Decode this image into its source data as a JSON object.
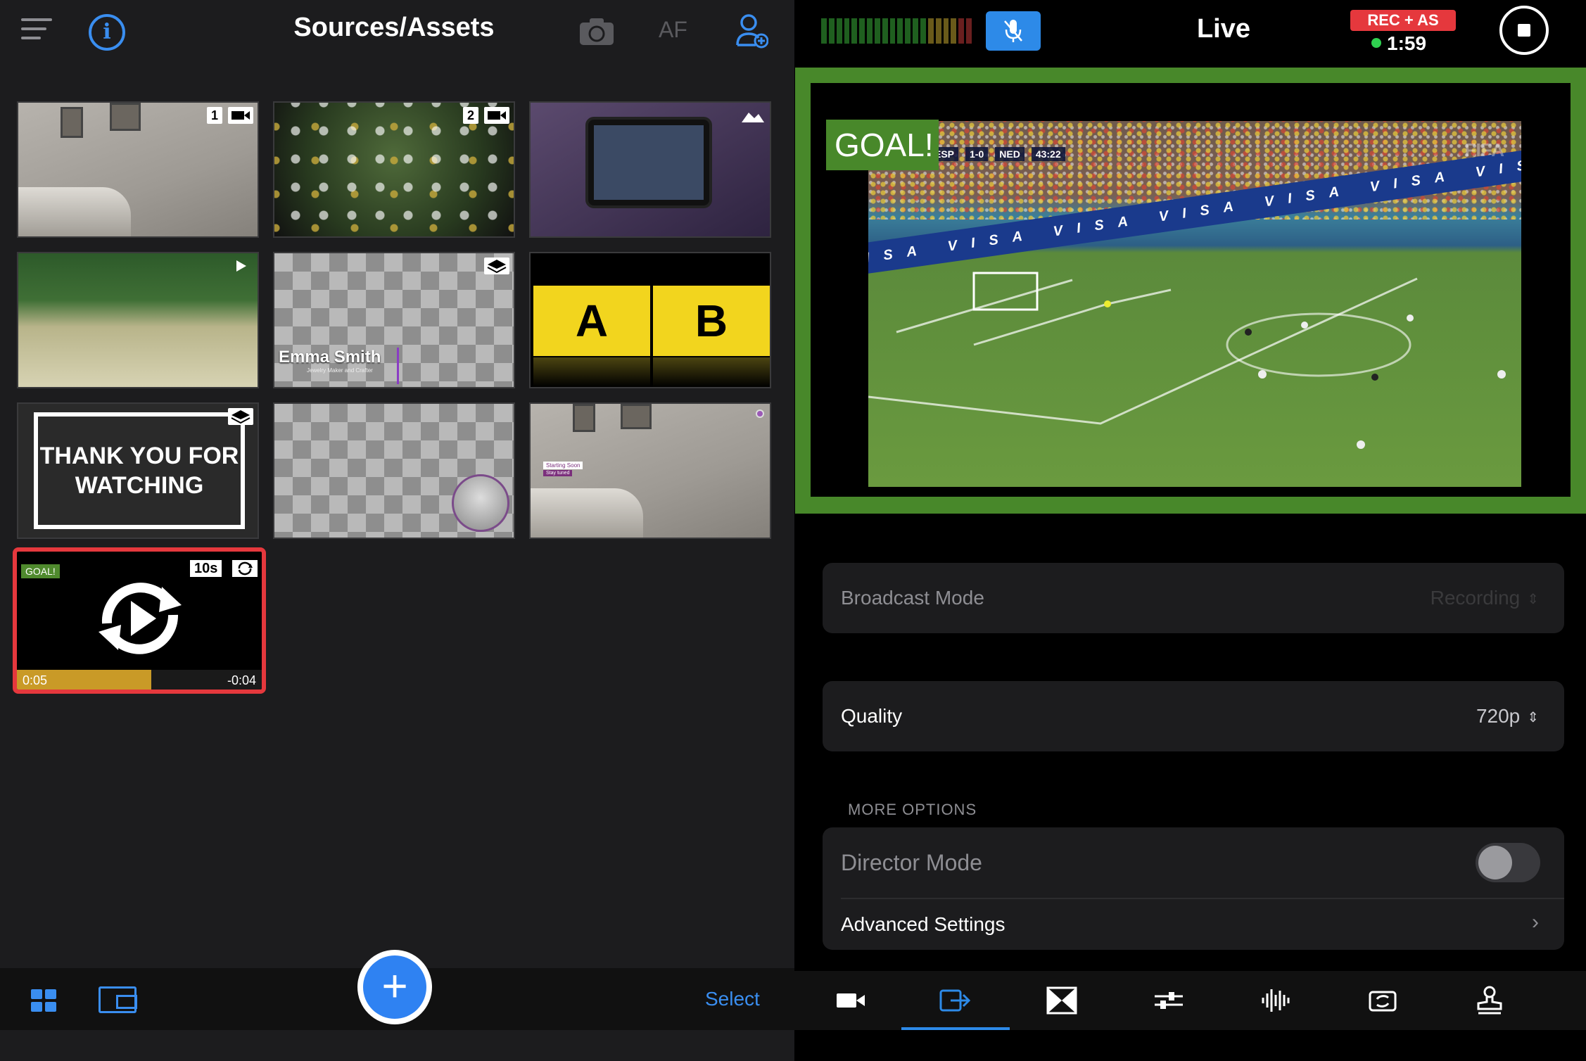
{
  "left_panel": {
    "title": "Sources/Assets",
    "af_label": "AF",
    "select_label": "Select",
    "tiles": [
      {
        "badge": "1"
      },
      {
        "badge": "2"
      },
      {
        "badge": ""
      },
      {
        "badge": ""
      },
      {
        "lower_third_name": "Emma Smith",
        "lower_third_sub": "Jewelry Maker and Crafter"
      },
      {
        "letter_a": "A",
        "letter_b": "B"
      },
      {
        "thanks_text": "THANK YOU FOR WATCHING"
      },
      {},
      {
        "overlay_title": "Starting Soon",
        "overlay_sub": "Stay tuned"
      }
    ],
    "active_clip": {
      "tag": "GOAL!",
      "duration": "10s",
      "elapsed": "0:05",
      "remaining": "-0:04",
      "progress": 0.55
    }
  },
  "right_panel": {
    "title": "Live",
    "rec_badge": "REC + AS",
    "rec_time": "1:59",
    "preview": {
      "goal_label": "GOAL!",
      "score_team1": "ESP",
      "score": "1-0",
      "score_team2": "NED",
      "match_clock": "43:22",
      "watermark": "FIFA",
      "board_text": "VISA VISA VISA VISA VISA VISA VISA VISA VISA VISA"
    },
    "settings": {
      "broadcast_mode_label": "Broadcast Mode",
      "broadcast_mode_value": "Recording",
      "quality_label": "Quality",
      "quality_value": "720p",
      "more_options_header": "MORE OPTIONS",
      "director_mode_label": "Director Mode",
      "director_mode_on": false,
      "advanced_settings_label": "Advanced Settings"
    },
    "tabs": [
      "camera-icon",
      "output-icon",
      "transition-icon",
      "adjust-icon",
      "audio-icon",
      "switch-camera-icon",
      "stamp-icon"
    ]
  },
  "colors": {
    "accent_blue": "#3a8ef0",
    "rec_red": "#e5383d",
    "preview_green": "#48882a",
    "live_dot": "#2fd150"
  }
}
